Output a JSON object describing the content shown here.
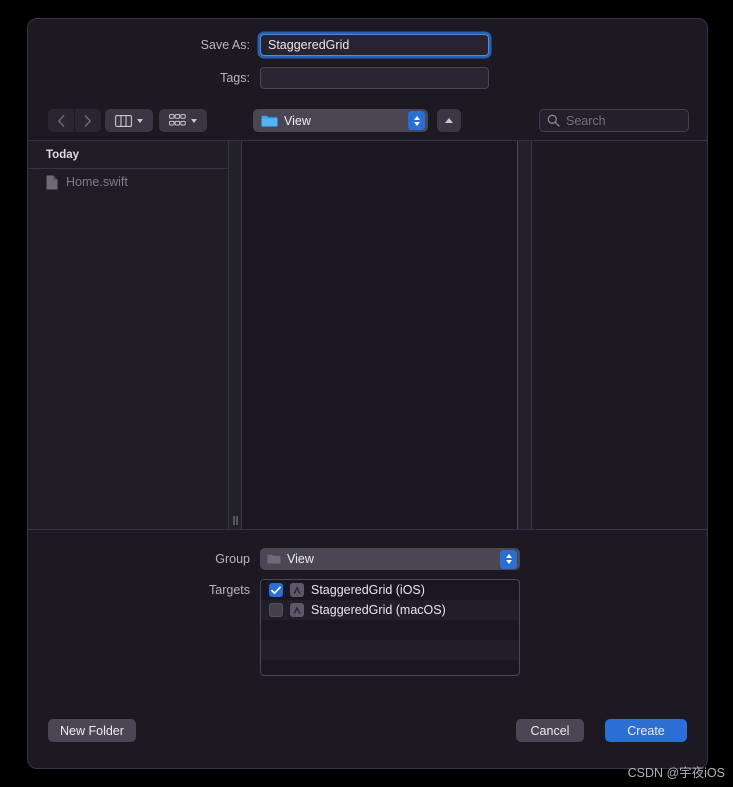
{
  "dialog": {
    "save_as": {
      "label": "Save As:",
      "value": "StaggeredGrid"
    },
    "tags": {
      "label": "Tags:",
      "value": "",
      "placeholder": ""
    }
  },
  "toolbar": {
    "back_icon": "chevron-left-icon",
    "forward_icon": "chevron-right-icon",
    "view_mode_icon": "column-view-icon",
    "group_mode_icon": "grid-view-icon",
    "path_popup": {
      "label": "View",
      "icon": "blue-folder-icon"
    },
    "up_button_icon": "chevron-up-icon",
    "search": {
      "placeholder": "Search",
      "value": "",
      "icon": "search-icon"
    }
  },
  "sidebar": {
    "header": "Today",
    "items": [
      {
        "label": "Home.swift",
        "icon": "document-icon"
      }
    ]
  },
  "options": {
    "group": {
      "label": "Group",
      "value": "View",
      "icon": "grey-folder-icon"
    },
    "targets": {
      "label": "Targets",
      "rows": [
        {
          "label": "StaggeredGrid (iOS)",
          "checked": true,
          "icon": "xcode-target-icon"
        },
        {
          "label": "StaggeredGrid (macOS)",
          "checked": false,
          "icon": "xcode-target-icon"
        }
      ]
    }
  },
  "buttons": {
    "new_folder": "New Folder",
    "cancel": "Cancel",
    "create": "Create"
  },
  "watermark": "CSDN @宇夜iOS",
  "colors": {
    "accent_blue": "#2b6fd4",
    "window_bg": "#1d1923",
    "sidebar_bg": "#201c26",
    "column_bg": "#1b1722",
    "control_bg": "#4a4654",
    "text_primary": "#eceaf1",
    "text_secondary": "#b9b5c0",
    "text_muted": "#807b8c"
  }
}
